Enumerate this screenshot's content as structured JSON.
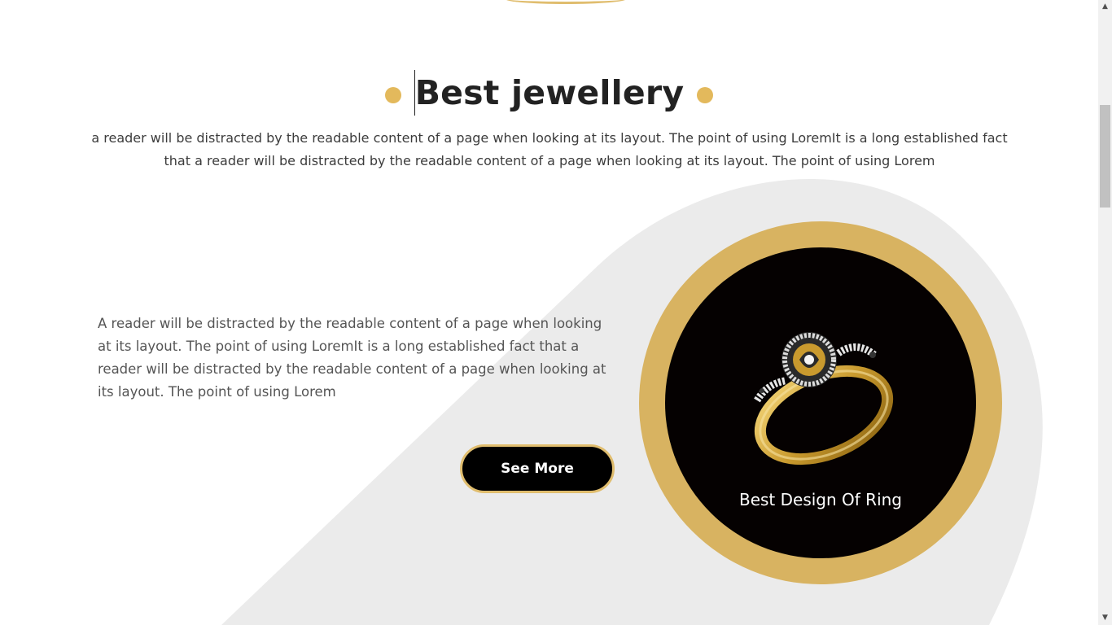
{
  "section": {
    "heading": "Best jewellery",
    "intro": "a reader will be distracted by the readable content of a page when looking at its layout. The point of using LoremIt is a long established fact that a reader will be distracted by the readable content of a page when looking at its layout. The point of using Lorem",
    "body": "A reader will be distracted by the readable content of a page when looking at its layout. The point of using LoremIt is a long established fact that a reader will be distracted by the readable content of a page when looking at its layout. The point of using Lorem",
    "button_label": "See More",
    "product_caption": "Best Design Of Ring"
  },
  "colors": {
    "accent_gold": "#d8b361",
    "dot_gold": "#e3b95c",
    "background_shape": "#ebebeb",
    "ring_background": "#050101",
    "heading_text": "#222222"
  },
  "icons": {
    "scroll_up": "scroll-up-arrow-icon",
    "scroll_down": "scroll-down-arrow-icon",
    "product": "diamond-ring-image"
  },
  "scrollbar": {
    "up_glyph": "▲",
    "down_glyph": "▼"
  }
}
